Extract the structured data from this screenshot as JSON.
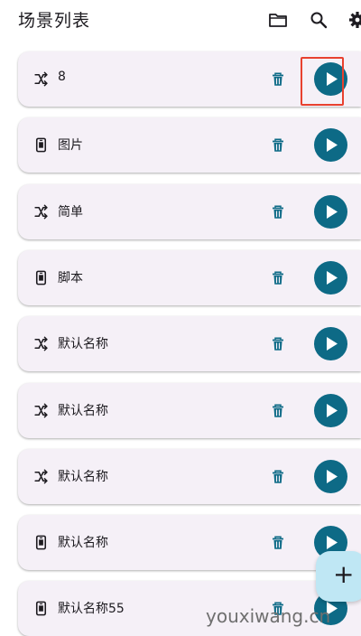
{
  "header": {
    "title": "场景列表",
    "icons": [
      "folder-icon",
      "search-icon",
      "gear-icon"
    ]
  },
  "scenes": [
    {
      "type": "shuffle-icon",
      "name": "8"
    },
    {
      "type": "phone-icon",
      "name": "图片"
    },
    {
      "type": "shuffle-icon",
      "name": "简单"
    },
    {
      "type": "phone-icon",
      "name": "脚本"
    },
    {
      "type": "shuffle-icon",
      "name": "默认名称"
    },
    {
      "type": "shuffle-icon",
      "name": "默认名称"
    },
    {
      "type": "shuffle-icon",
      "name": "默认名称"
    },
    {
      "type": "phone-icon",
      "name": "默认名称"
    },
    {
      "type": "phone-icon",
      "name": "默认名称55"
    }
  ],
  "fab": {
    "label": "+"
  },
  "watermark": "youxiwang.cn",
  "colors": {
    "accent": "#0d6a86",
    "card_bg": "#f5f0f7",
    "highlight": "#e8412f",
    "fab_bg": "#bfe7f4"
  }
}
